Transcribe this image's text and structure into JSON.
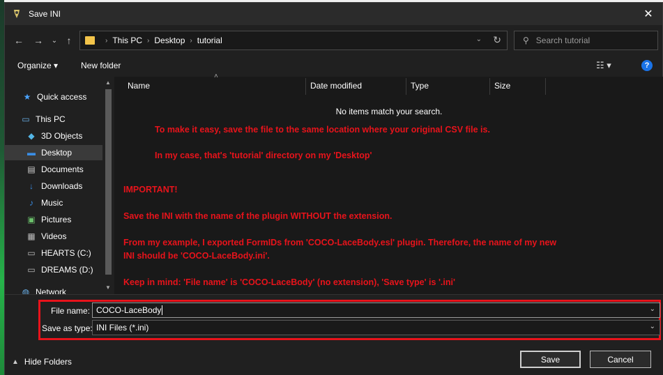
{
  "window": {
    "title": "Save INI",
    "close_label": "✕"
  },
  "nav_buttons": {
    "back": "←",
    "forward": "→",
    "recent": "⌄",
    "up": "↑"
  },
  "address": {
    "crumbs": [
      "This PC",
      "Desktop",
      "tutorial"
    ],
    "sep": "›",
    "dropdown": "⌄",
    "refresh": "↻"
  },
  "search": {
    "placeholder": "Search tutorial",
    "icon": "⚲"
  },
  "toolbar": {
    "organize": "Organize ▾",
    "new_folder": "New folder",
    "view": "☷ ▾",
    "help": "?"
  },
  "sidebar": {
    "items": [
      {
        "label": "Quick access",
        "icon": "★",
        "color": "#4aa3ff"
      },
      {
        "label": "This PC",
        "icon": "▭",
        "color": "#6ab0e8"
      },
      {
        "label": "3D Objects",
        "icon": "◆",
        "color": "#54b6e6"
      },
      {
        "label": "Desktop",
        "icon": "▬",
        "color": "#3a8ee6"
      },
      {
        "label": "Documents",
        "icon": "▤",
        "color": "#cfcfcf"
      },
      {
        "label": "Downloads",
        "icon": "↓",
        "color": "#3a8ee6"
      },
      {
        "label": "Music",
        "icon": "♪",
        "color": "#3a8ee6"
      },
      {
        "label": "Pictures",
        "icon": "▣",
        "color": "#6bc06b"
      },
      {
        "label": "Videos",
        "icon": "▦",
        "color": "#bbbbbb"
      },
      {
        "label": "HEARTS (C:)",
        "icon": "▭",
        "color": "#bbbbbb"
      },
      {
        "label": "DREAMS (D:)",
        "icon": "▭",
        "color": "#bbbbbb"
      },
      {
        "label": "Network",
        "icon": "◍",
        "color": "#6ab0e8"
      }
    ],
    "selected": "Desktop"
  },
  "columns": [
    "Name",
    "Date modified",
    "Type",
    "Size"
  ],
  "sort_indicator": "˄",
  "empty_message": "No items match your search.",
  "notes": [
    "To make it easy, save the file to the same location where your original CSV file is.",
    "In my case, that's 'tutorial' directory on my 'Desktop'",
    "IMPORTANT!",
    "Save the INI with the name of the plugin WITHOUT the extension.",
    "From my example, I exported FormIDs from 'COCO-LaceBody.esl' plugin. Therefore, the name of my new",
    "INI should be 'COCO-LaceBody.ini'.",
    "Keep in mind: 'File name' is 'COCO-LaceBody' (no extension), 'Save type' is '.ini'"
  ],
  "form": {
    "file_name_label": "File name:",
    "file_name_value": "COCO-LaceBody",
    "save_type_label": "Save as type:",
    "save_type_value": "INI Files (*.ini)",
    "chevron": "⌄"
  },
  "footer": {
    "hide_folders": "Hide Folders",
    "hide_arrow": "▲",
    "save": "Save",
    "cancel": "Cancel"
  },
  "colors": {
    "annotation": "#e8131b",
    "accent": "#1a73e8"
  }
}
